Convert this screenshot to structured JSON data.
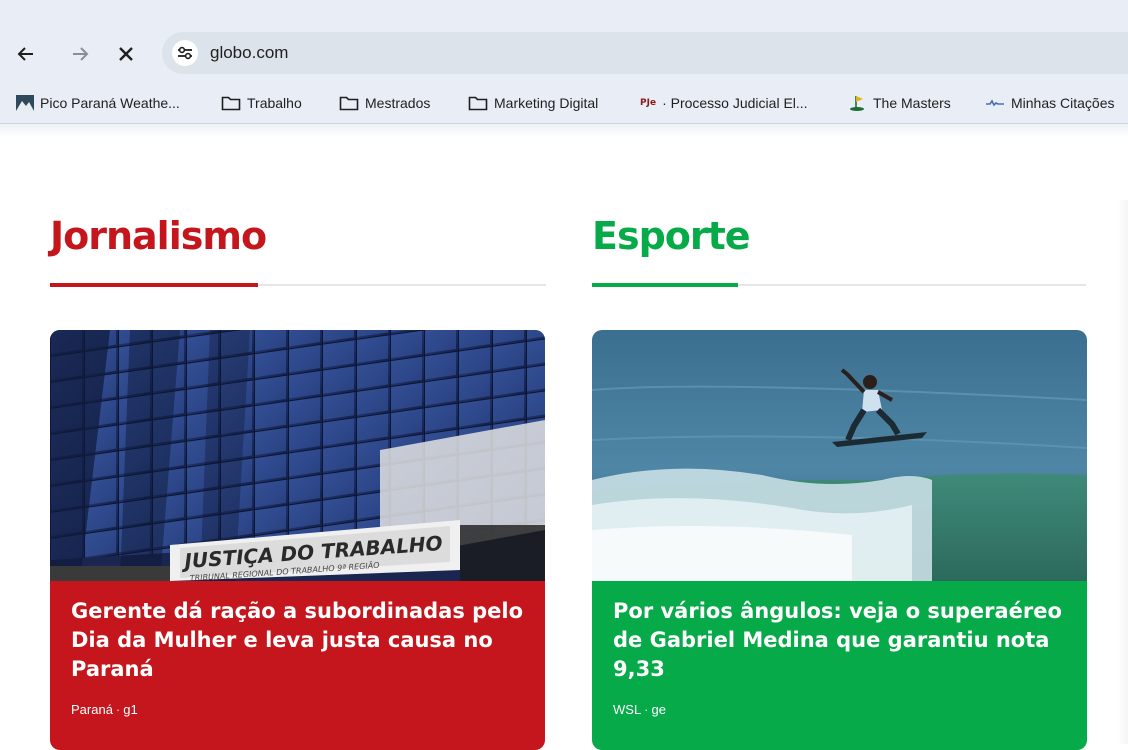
{
  "browser": {
    "url": "globo.com",
    "back_icon": "arrow-left-icon",
    "forward_icon": "arrow-right-icon",
    "stop_icon": "close-icon",
    "site_info_icon": "tune-icon"
  },
  "bookmarks": [
    {
      "label": "Pico Paraná Weathe...",
      "icon": "mountain-favicon"
    },
    {
      "label": "Trabalho",
      "icon": "folder-icon"
    },
    {
      "label": "Mestrados",
      "icon": "folder-icon"
    },
    {
      "label": "Marketing Digital",
      "icon": "folder-icon"
    },
    {
      "label": "· Processo Judicial El...",
      "icon": "pje-favicon",
      "icon_text": "PJe"
    },
    {
      "label": "The Masters",
      "icon": "golf-favicon"
    },
    {
      "label": "Minhas Citações",
      "icon": "scholar-favicon"
    }
  ],
  "sections": [
    {
      "title": "Jornalismo",
      "color": "#c4161c",
      "card": {
        "image_sign_line1": "JUSTIÇA DO TRABALHO",
        "image_sign_line2": "TRIBUNAL REGIONAL DO TRABALHO 9ª REGIÃO",
        "headline": "Gerente dá ração a subordinadas pelo Dia da Mulher e leva justa causa no Paraná",
        "meta_region": "Paraná",
        "meta_source": "g1",
        "bg": "#c4161c"
      }
    },
    {
      "title": "Esporte",
      "color": "#06aa48",
      "card": {
        "headline": "Por vários ângulos: veja o superaéreo de Gabriel Medina que garantiu nota 9,33",
        "meta_region": "WSL",
        "meta_source": "ge",
        "bg": "#06aa48"
      }
    }
  ],
  "meta_separator": "·"
}
